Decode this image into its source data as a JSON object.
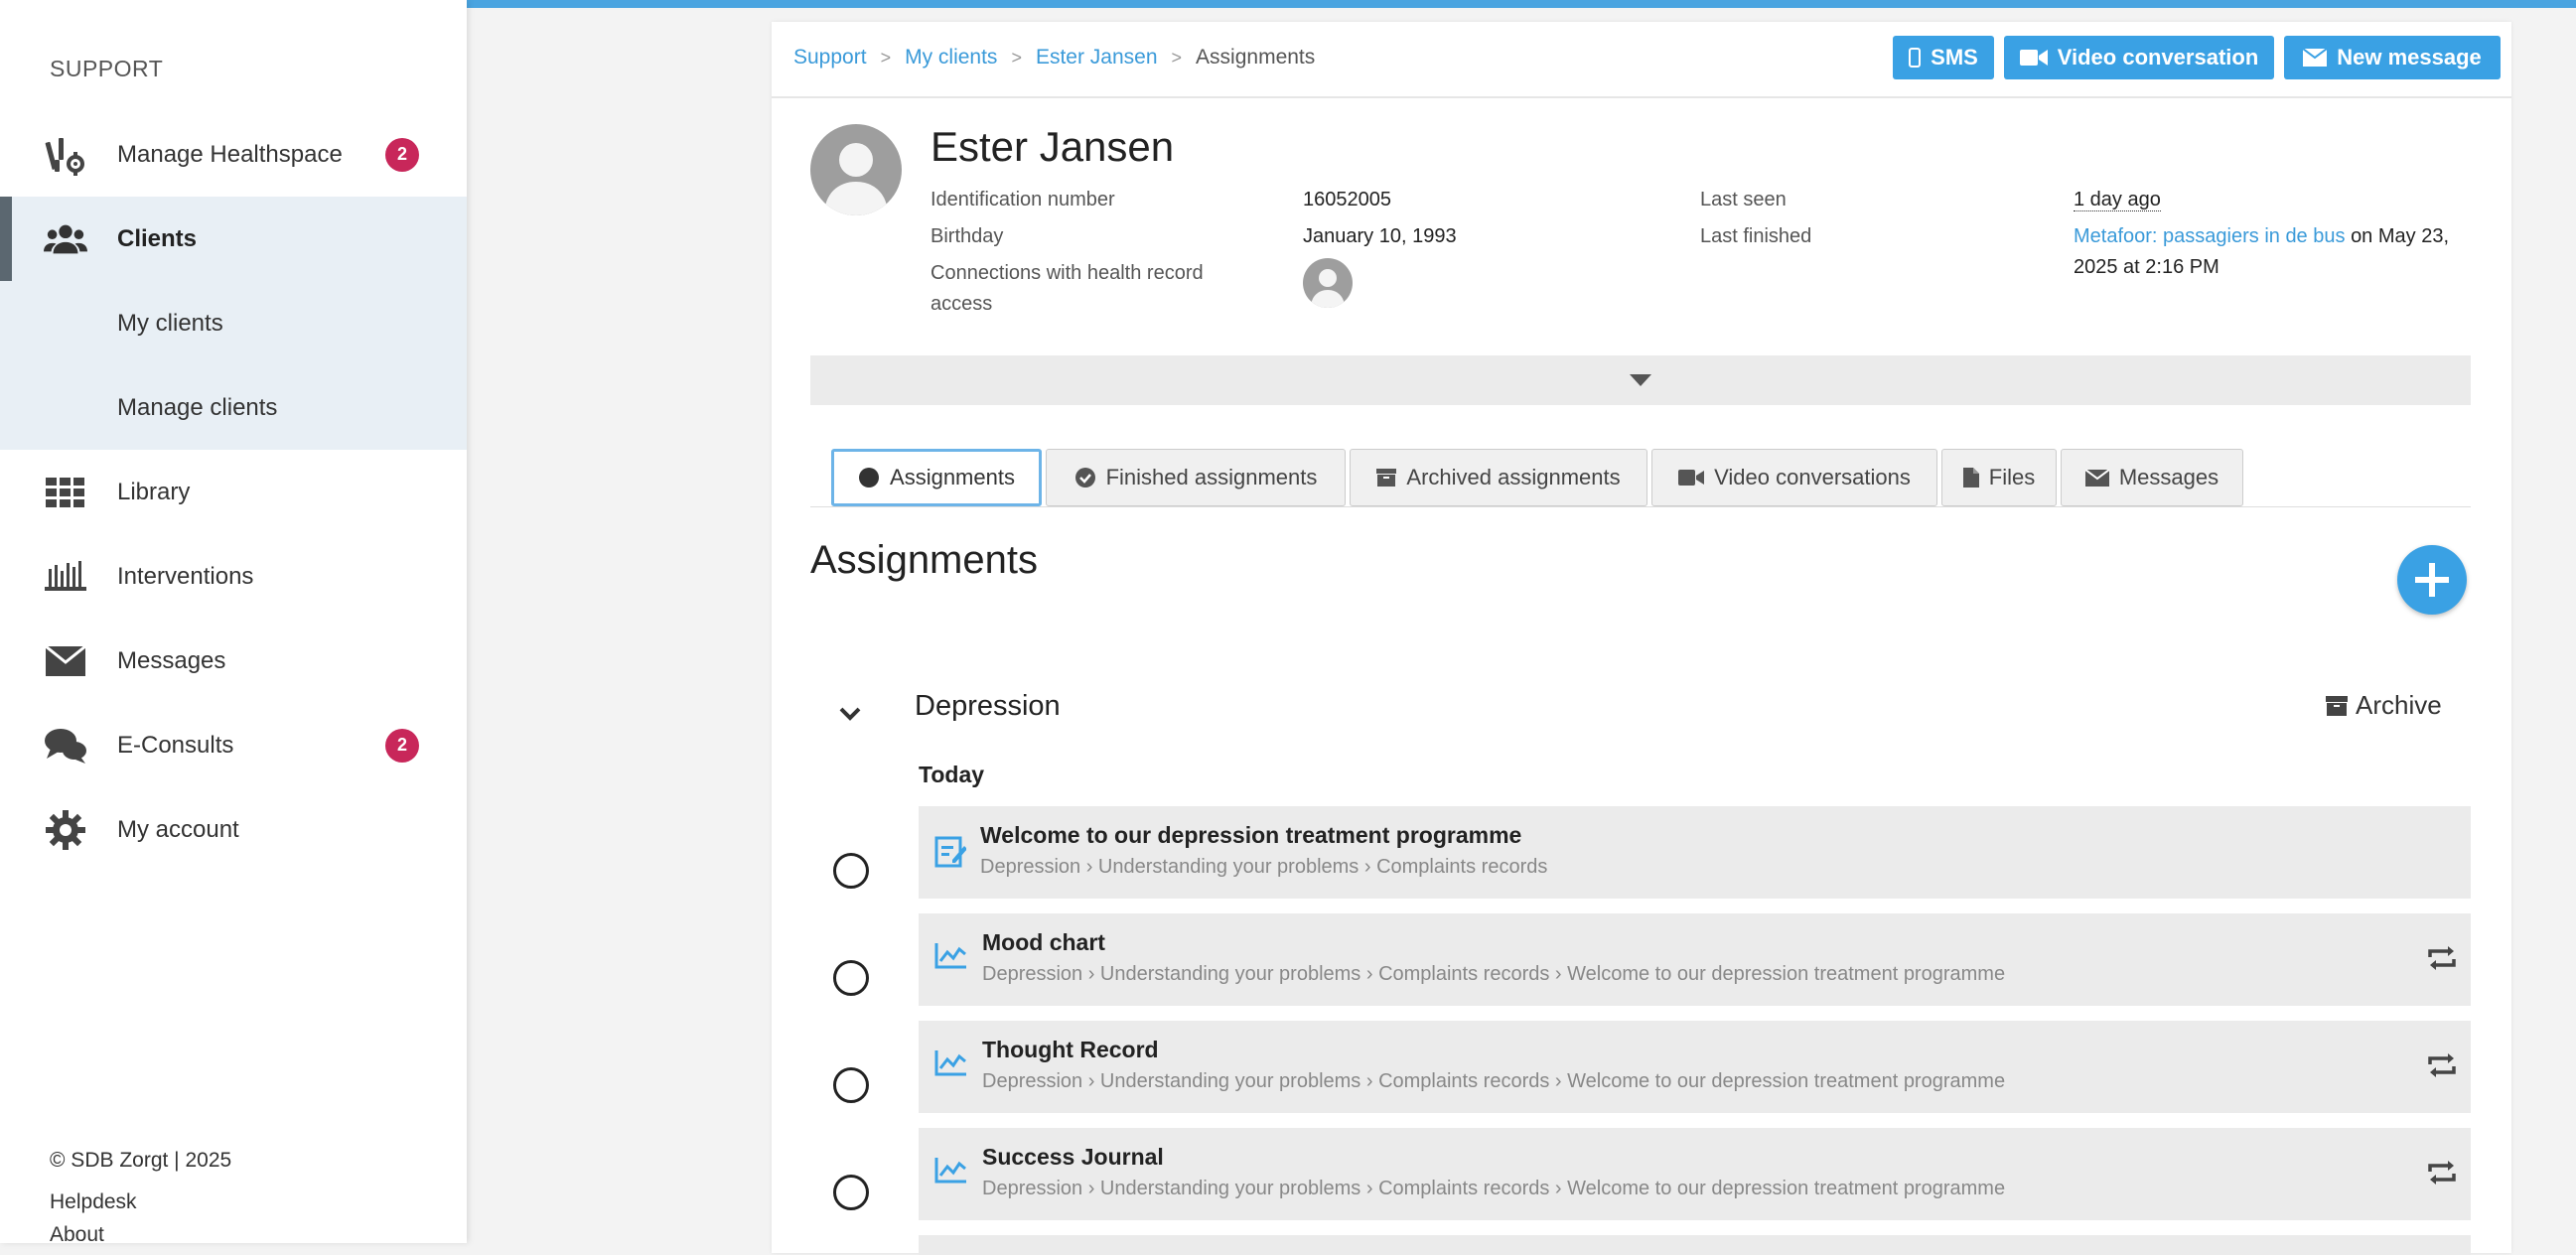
{
  "sidebar": {
    "header": "SUPPORT",
    "items": [
      {
        "label": "Manage Healthspace",
        "badge": "2",
        "icon": "healthspace-icon"
      },
      {
        "label": "Clients",
        "icon": "clients-icon"
      },
      {
        "label": "My clients"
      },
      {
        "label": "Manage clients"
      },
      {
        "label": "Library",
        "icon": "grid-icon"
      },
      {
        "label": "Interventions",
        "icon": "interventions-icon"
      },
      {
        "label": "Messages",
        "icon": "envelope-icon"
      },
      {
        "label": "E-Consults",
        "badge": "2",
        "icon": "chat-icon"
      },
      {
        "label": "My account",
        "icon": "gear-icon"
      }
    ],
    "footer": {
      "copyright": "© SDB Zorgt | 2025",
      "helpdesk": "Helpdesk",
      "about": "About"
    }
  },
  "breadcrumb": {
    "items": [
      "Support",
      "My clients",
      "Ester Jansen"
    ],
    "current": "Assignments"
  },
  "actions": {
    "sms": "SMS",
    "video": "Video conversation",
    "new_message": "New message"
  },
  "client": {
    "name": "Ester Jansen",
    "id_label": "Identification number",
    "id_value": "16052005",
    "birthday_label": "Birthday",
    "birthday_value": "January 10, 1993",
    "connections_label": "Connections with health record access",
    "last_seen_label": "Last seen",
    "last_seen_value": "1 day ago",
    "last_finished_label": "Last finished",
    "last_finished_link": "Metafoor: passagiers in de bus",
    "last_finished_on": "on May 23, 2025 at 2:16 PM"
  },
  "tabs": [
    "Assignments",
    "Finished assignments",
    "Archived assignments",
    "Video conversations",
    "Files",
    "Messages"
  ],
  "section_title": "Assignments",
  "group": {
    "title": "Depression",
    "archive": "Archive",
    "day": "Today",
    "assignments": [
      {
        "title": "Welcome to our depression treatment programme",
        "path": "Depression › Understanding your problems › Complaints records",
        "icon": "form-edit-icon",
        "repeat": false
      },
      {
        "title": "Mood chart",
        "path": "Depression › Understanding your problems › Complaints records › Welcome to our depression treatment programme",
        "icon": "line-chart-icon",
        "repeat": true
      },
      {
        "title": "Thought Record",
        "path": "Depression › Understanding your problems › Complaints records › Welcome to our depression treatment programme",
        "icon": "line-chart-icon",
        "repeat": true
      },
      {
        "title": "Success Journal",
        "path": "Depression › Understanding your problems › Complaints records › Welcome to our depression treatment programme",
        "icon": "line-chart-icon",
        "repeat": true
      }
    ]
  },
  "colors": {
    "accent": "#3aa1e4",
    "badge": "#c8275a",
    "sidebar_active": "#e8eff5",
    "row_bg": "#ebebeb"
  }
}
